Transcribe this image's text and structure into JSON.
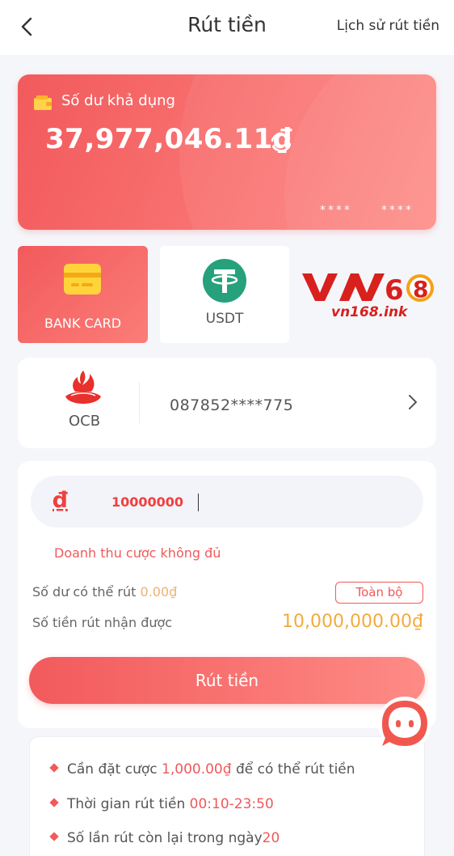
{
  "header": {
    "title": "Rút tiền",
    "history_label": "Lịch sử rút tiền"
  },
  "balance_card": {
    "label": "Số dư khả dụng",
    "amount": "37,977,046.11₫",
    "mask_1": "****",
    "mask_2": "****"
  },
  "methods": [
    {
      "label": "BANK CARD",
      "selected": true
    },
    {
      "label": "USDT",
      "selected": false
    }
  ],
  "watermark": {
    "url": "vn168.ink"
  },
  "bank": {
    "name": "OCB",
    "account": "087852****775"
  },
  "form": {
    "currency_symbol": "₫",
    "amount_value": "10000000",
    "error": "Doanh thu cược không đủ",
    "available_label": "Số dư có thể rút",
    "available_value": "0.00₫",
    "all_button": "Toàn bộ",
    "receive_label": "Số tiền rút nhận được",
    "receive_value": "10,000,000.00₫"
  },
  "withdraw_button": "Rút tiền",
  "notice": {
    "row1_pre": "Cần đặt cược",
    "row1_value": "1,000.00₫",
    "row1_post": "để có thể rút tiền",
    "row2_pre": "Thời gian rút tiền",
    "row2_value": "00:10-23:50",
    "row3_pre": "Số lần rút còn lại trong ngày",
    "row3_value": "20"
  },
  "colors": {
    "accent": "#f25a5c",
    "accent_light": "#fd8c86",
    "highlight_orange": "#f3ab3d",
    "text_dark": "#333333"
  }
}
